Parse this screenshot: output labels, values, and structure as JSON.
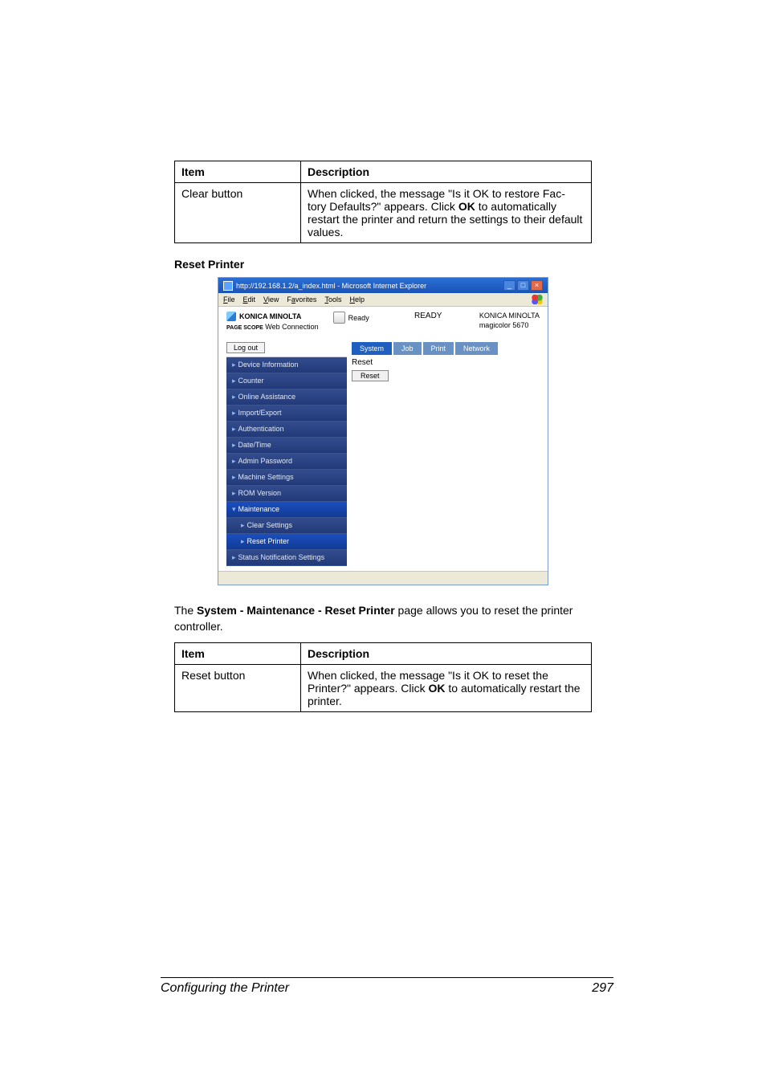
{
  "table1": {
    "header_item": "Item",
    "header_desc": "Description",
    "row_item": "Clear button",
    "row_desc_1": "When clicked, the message \"Is it OK to restore Fac-",
    "row_desc_2": "tory Defaults?\" appears. Click ",
    "row_desc_bold": "OK",
    "row_desc_3": " to automatically restart the printer and return the settings to their default values."
  },
  "heading": "Reset Printer",
  "shot": {
    "title": "http://192.168.1.2/a_index.html - Microsoft Internet Explorer",
    "menus": [
      "File",
      "Edit",
      "View",
      "Favorites",
      "Tools",
      "Help"
    ],
    "brand": "KONICA MINOLTA",
    "webcon_prefix": "PAGE SCOPE",
    "webcon": " Web Connection",
    "ready_label": "Ready",
    "ready_center": "READY",
    "device_brand": "KONICA MINOLTA",
    "device_model": "magicolor 5670",
    "logout": "Log out",
    "tabs": [
      "System",
      "Job",
      "Print",
      "Network"
    ],
    "menu": [
      {
        "label": "Device Information",
        "sub": false,
        "sel": false,
        "tri": "▸"
      },
      {
        "label": "Counter",
        "sub": false,
        "sel": false,
        "tri": "▸"
      },
      {
        "label": "Online Assistance",
        "sub": false,
        "sel": false,
        "tri": "▸"
      },
      {
        "label": "Import/Export",
        "sub": false,
        "sel": false,
        "tri": "▸"
      },
      {
        "label": "Authentication",
        "sub": false,
        "sel": false,
        "tri": "▸"
      },
      {
        "label": "Date/Time",
        "sub": false,
        "sel": false,
        "tri": "▸"
      },
      {
        "label": "Admin Password",
        "sub": false,
        "sel": false,
        "tri": "▸"
      },
      {
        "label": "Machine Settings",
        "sub": false,
        "sel": false,
        "tri": "▸"
      },
      {
        "label": "ROM Version",
        "sub": false,
        "sel": false,
        "tri": "▸"
      },
      {
        "label": "Maintenance",
        "sub": false,
        "sel": true,
        "tri": "▾"
      },
      {
        "label": "Clear Settings",
        "sub": true,
        "sel": false,
        "tri": "▸"
      },
      {
        "label": "Reset Printer",
        "sub": true,
        "sel": true,
        "tri": "▸"
      },
      {
        "label": "Status Notification Settings",
        "sub": false,
        "sel": false,
        "tri": "▸"
      }
    ],
    "panel_title": "Reset",
    "reset_btn": "Reset"
  },
  "caption_pre": "The ",
  "caption_bold": "System - Maintenance - Reset Printer",
  "caption_post": " page allows you to reset the printer controller.",
  "table2": {
    "header_item": "Item",
    "header_desc": "Description",
    "row_item": "Reset button",
    "row_desc_1": "When clicked, the message \"Is it OK to reset the Printer?\" appears. Click ",
    "row_desc_bold": "OK",
    "row_desc_2": " to automatically restart the printer."
  },
  "footer_left": "Configuring the Printer",
  "footer_right": "297"
}
